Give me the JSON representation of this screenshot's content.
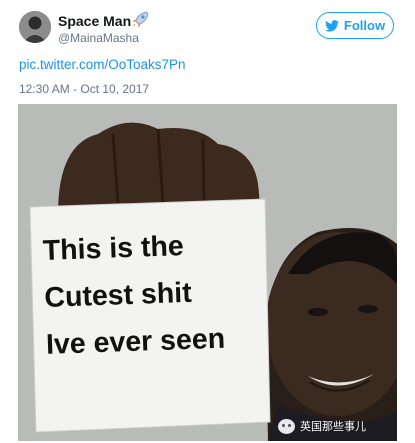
{
  "tweet": {
    "display_name": "Space Man",
    "name_emoji_icon": "rocket-icon",
    "handle": "@MainaMasha",
    "follow_label": "Follow",
    "follow_icon": "twitter-bird-icon",
    "link_text": "pic.twitter.com/OoToaks7Pn",
    "timestamp": "12:30 AM - Oct 10, 2017",
    "accent_color": "#1da1f2"
  },
  "media": {
    "sign_lines": [
      "This is the",
      "Cutest shit",
      "Ive ever seen"
    ]
  },
  "watermark": {
    "icon": "wechat-icon",
    "text": "英国那些事儿"
  }
}
